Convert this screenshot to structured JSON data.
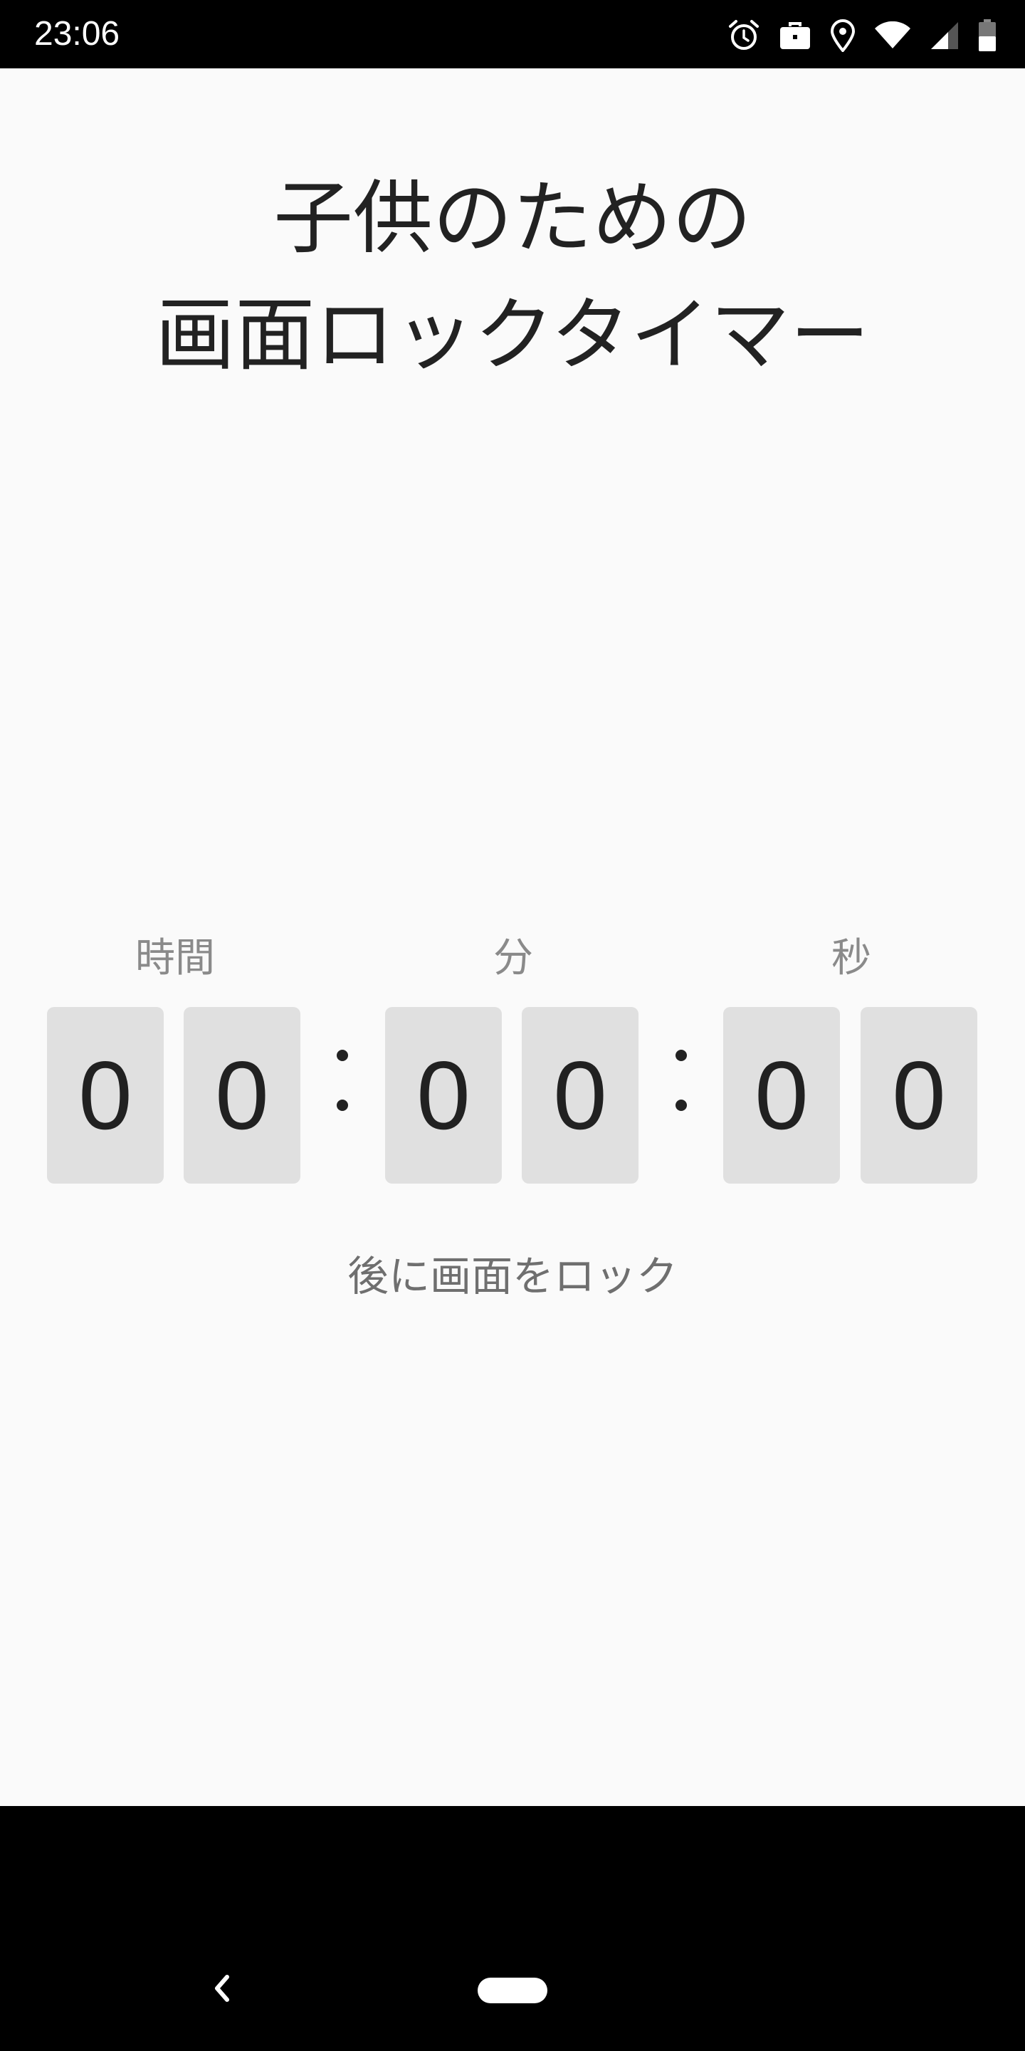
{
  "status_bar": {
    "time": "23:06",
    "icons": [
      "alarm-icon",
      "work-briefcase-icon",
      "location-icon",
      "wifi-icon",
      "cell-signal-icon",
      "battery-icon"
    ]
  },
  "title": {
    "line1": "子供のための",
    "line2": "画面ロックタイマー"
  },
  "timer": {
    "hours_label": "時間",
    "minutes_label": "分",
    "seconds_label": "秒",
    "hours_tens": "0",
    "hours_ones": "0",
    "minutes_tens": "0",
    "minutes_ones": "0",
    "seconds_tens": "0",
    "seconds_ones": "0"
  },
  "subtitle": "後に画面をロック",
  "nav_bar": {
    "icons": [
      "back-chevron-icon",
      "home-pill-icon"
    ]
  }
}
